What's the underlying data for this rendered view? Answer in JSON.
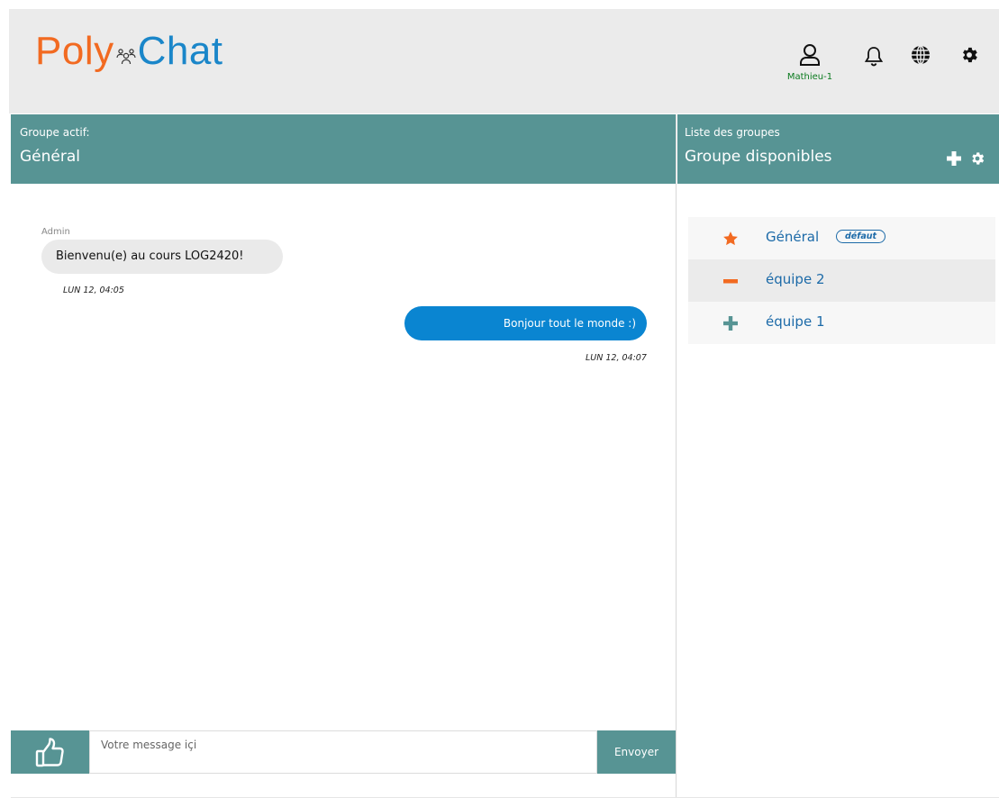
{
  "app": {
    "logo_left": "Poly",
    "logo_right": "Chat",
    "brand_colors": {
      "poly": "#f26a21",
      "chat": "#1a86c9",
      "accent": "#579494"
    }
  },
  "topbar": {
    "username": "Mathieu-1",
    "icons": [
      "user-icon",
      "bell-icon",
      "globe-icon",
      "gear-icon"
    ]
  },
  "left_panel": {
    "subtitle": "Groupe actif:",
    "title": "Général"
  },
  "right_panel": {
    "subtitle": "Liste des groupes",
    "title": "Groupe disponibles",
    "icons": [
      "plus-icon",
      "gear-icon"
    ]
  },
  "messages": [
    {
      "sender": "Admin",
      "text": "Bienvenu(e) au cours LOG2420!",
      "time": "LUN 12, 04:05",
      "direction": "incoming"
    },
    {
      "sender": "",
      "text": "Bonjour tout le monde :)",
      "time": "LUN 12, 04:07",
      "direction": "outgoing"
    }
  ],
  "composer": {
    "placeholder": "Votre message içi",
    "send_label": "Envoyer",
    "like_icon": "thumbs-up-icon"
  },
  "groups": [
    {
      "name": "Général",
      "badge": "défaut",
      "icon": "star-icon",
      "icon_color": "#f26a21"
    },
    {
      "name": "équipe 2",
      "badge": "",
      "icon": "minus-icon",
      "icon_color": "#f26a21"
    },
    {
      "name": "équipe 1",
      "badge": "",
      "icon": "plus-icon",
      "icon_color": "#579494"
    }
  ]
}
